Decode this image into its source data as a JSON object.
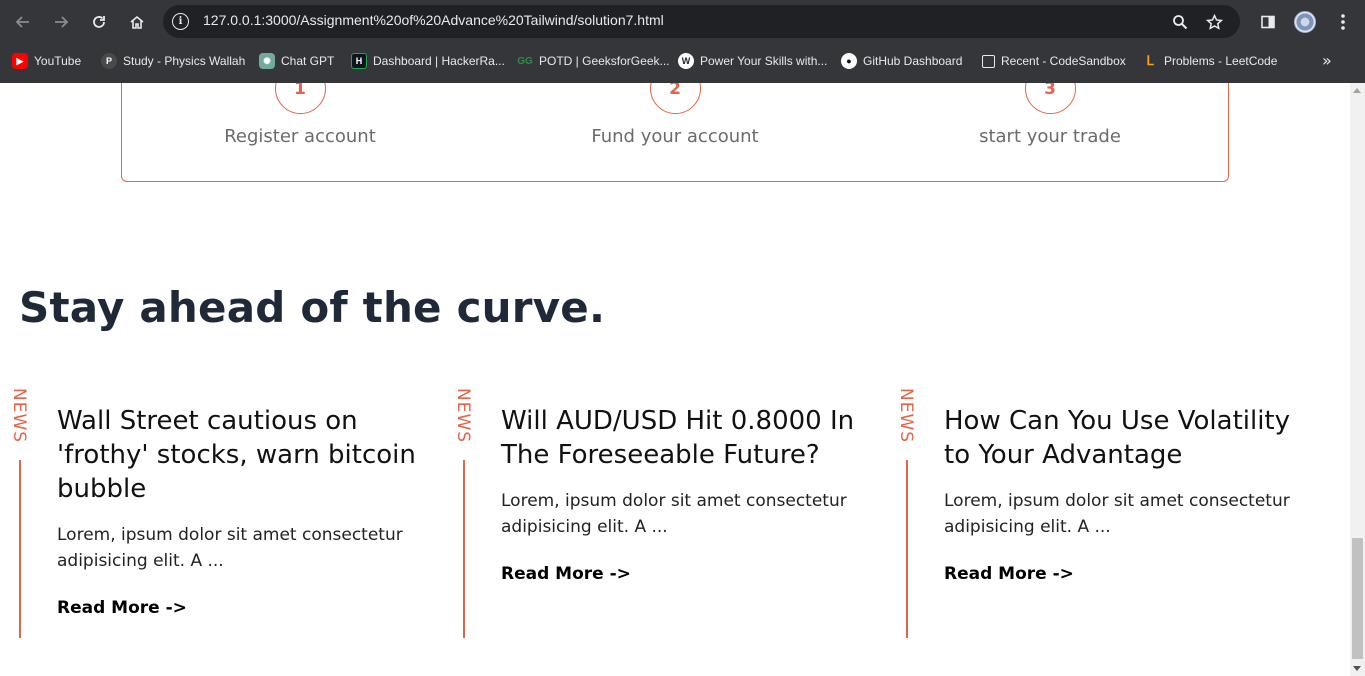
{
  "browser": {
    "url": "127.0.0.1:3000/Assignment%20of%20Advance%20Tailwind/solution7.html",
    "bookmarks": [
      {
        "label": "YouTube",
        "icon": "youtube-icon",
        "color": "#ff0000"
      },
      {
        "label": "Study - Physics Wallah",
        "icon": "physics-wallah-icon",
        "color": "#555555"
      },
      {
        "label": "Chat GPT",
        "icon": "chatgpt-icon",
        "color": "#74aa9c"
      },
      {
        "label": "Dashboard | HackerRa...",
        "icon": "hackerrank-icon",
        "color": "#1ba94c"
      },
      {
        "label": "POTD | GeeksforGeek...",
        "icon": "geeksforgeeks-icon",
        "color": "#2f8d46"
      },
      {
        "label": "Power Your Skills with...",
        "icon": "wordpress-icon",
        "color": "#ffffff"
      },
      {
        "label": "GitHub Dashboard",
        "icon": "github-icon",
        "color": "#ffffff"
      },
      {
        "label": "Recent - CodeSandbox",
        "icon": "codesandbox-icon",
        "color": "#ffffff"
      },
      {
        "label": "Problems - LeetCode",
        "icon": "leetcode-icon",
        "color": "#ffa116"
      }
    ]
  },
  "steps": [
    {
      "number": "1",
      "label": "Register account"
    },
    {
      "number": "2",
      "label": "Fund your account"
    },
    {
      "number": "3",
      "label": "start your trade"
    }
  ],
  "section": {
    "heading": "Stay ahead of the curve."
  },
  "news": [
    {
      "tag": "NEWS",
      "title": "Wall Street cautious on 'frothy' stocks, warn bitcoin bubble",
      "excerpt": "Lorem, ipsum dolor sit amet consectetur adipisicing elit. A ...",
      "link": "Read More ->"
    },
    {
      "tag": "NEWS",
      "title": "Will AUD/USD Hit 0.8000 In The Foreseeable Future?",
      "excerpt": "Lorem, ipsum dolor sit amet consectetur adipisicing elit. A ...",
      "link": "Read More ->"
    },
    {
      "tag": "NEWS",
      "title": "How Can You Use Volatility to Your Advantage",
      "excerpt": "Lorem, ipsum dolor sit amet consectetur adipisicing elit. A ...",
      "link": "Read More ->"
    }
  ],
  "colors": {
    "accent": "#e2644a",
    "heading": "#1f2937",
    "chrome": "#35363a"
  }
}
